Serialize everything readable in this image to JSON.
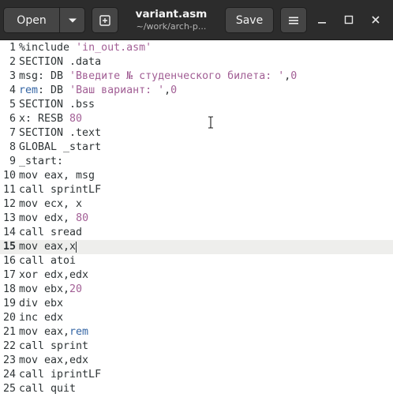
{
  "header": {
    "open_label": "Open",
    "save_label": "Save",
    "title": "variant.asm",
    "subtitle": "~/work/arch-p...",
    "icons": {
      "open_menu": "chevron-down-icon",
      "new_tab": "new-tab-icon",
      "menu": "hamburger-menu-icon",
      "minimize": "minimize-icon",
      "maximize": "maximize-icon",
      "close": "close-icon"
    }
  },
  "editor": {
    "current_line": 15,
    "lines": [
      {
        "n": "1",
        "tokens": [
          {
            "t": "%include ",
            "c": "kw"
          },
          {
            "t": "'in_out.asm'",
            "c": "str"
          }
        ]
      },
      {
        "n": "2",
        "tokens": [
          {
            "t": "SECTION .data",
            "c": "kw"
          }
        ]
      },
      {
        "n": "3",
        "tokens": [
          {
            "t": "msg: DB ",
            "c": "kw"
          },
          {
            "t": "'Введите № студенческого билета: '",
            "c": "str"
          },
          {
            "t": ",",
            "c": "kw"
          },
          {
            "t": "0",
            "c": "num"
          }
        ]
      },
      {
        "n": "4",
        "tokens": [
          {
            "t": "rem",
            "c": "lbl"
          },
          {
            "t": ": DB ",
            "c": "kw"
          },
          {
            "t": "'Ваш вариант: '",
            "c": "str"
          },
          {
            "t": ",",
            "c": "kw"
          },
          {
            "t": "0",
            "c": "num"
          }
        ]
      },
      {
        "n": "5",
        "tokens": [
          {
            "t": "SECTION .bss",
            "c": "kw"
          }
        ]
      },
      {
        "n": "6",
        "tokens": [
          {
            "t": "x: RESB ",
            "c": "kw"
          },
          {
            "t": "80",
            "c": "num"
          }
        ]
      },
      {
        "n": "7",
        "tokens": [
          {
            "t": "SECTION .text",
            "c": "kw"
          }
        ]
      },
      {
        "n": "8",
        "tokens": [
          {
            "t": "GLOBAL _start",
            "c": "kw"
          }
        ]
      },
      {
        "n": "9",
        "tokens": [
          {
            "t": "_start:",
            "c": "kw"
          }
        ]
      },
      {
        "n": "10",
        "tokens": [
          {
            "t": "mov eax, msg",
            "c": "kw"
          }
        ]
      },
      {
        "n": "11",
        "tokens": [
          {
            "t": "call sprintLF",
            "c": "kw"
          }
        ]
      },
      {
        "n": "12",
        "tokens": [
          {
            "t": "mov ecx, x",
            "c": "kw"
          }
        ]
      },
      {
        "n": "13",
        "tokens": [
          {
            "t": "mov edx, ",
            "c": "kw"
          },
          {
            "t": "80",
            "c": "num"
          }
        ]
      },
      {
        "n": "14",
        "tokens": [
          {
            "t": "call sread",
            "c": "kw"
          }
        ]
      },
      {
        "n": "15",
        "tokens": [
          {
            "t": "mov eax,x",
            "c": "kw"
          }
        ]
      },
      {
        "n": "16",
        "tokens": [
          {
            "t": "call atoi",
            "c": "kw"
          }
        ]
      },
      {
        "n": "17",
        "tokens": [
          {
            "t": "xor edx,edx",
            "c": "kw"
          }
        ]
      },
      {
        "n": "18",
        "tokens": [
          {
            "t": "mov ebx,",
            "c": "kw"
          },
          {
            "t": "20",
            "c": "num"
          }
        ]
      },
      {
        "n": "19",
        "tokens": [
          {
            "t": "div ebx",
            "c": "kw"
          }
        ]
      },
      {
        "n": "20",
        "tokens": [
          {
            "t": "inc edx",
            "c": "kw"
          }
        ]
      },
      {
        "n": "21",
        "tokens": [
          {
            "t": "mov eax,",
            "c": "kw"
          },
          {
            "t": "rem",
            "c": "lbl"
          }
        ]
      },
      {
        "n": "22",
        "tokens": [
          {
            "t": "call sprint",
            "c": "kw"
          }
        ]
      },
      {
        "n": "23",
        "tokens": [
          {
            "t": "mov eax,edx",
            "c": "kw"
          }
        ]
      },
      {
        "n": "24",
        "tokens": [
          {
            "t": "call iprintLF",
            "c": "kw"
          }
        ]
      },
      {
        "n": "25",
        "tokens": [
          {
            "t": "call quit",
            "c": "kw"
          }
        ]
      }
    ]
  }
}
